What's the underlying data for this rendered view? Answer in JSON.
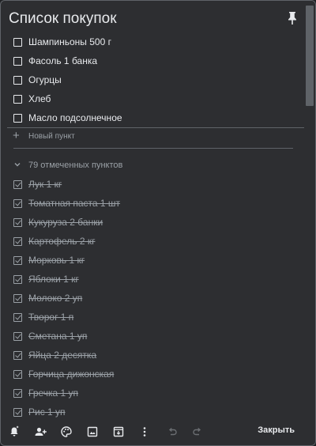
{
  "note": {
    "title": "Список покупок"
  },
  "unchecked_items": [
    {
      "label": "Шампиньоны 500 г",
      "checked": false
    },
    {
      "label": "Фасоль 1 банка",
      "checked": false
    },
    {
      "label": "Огурцы",
      "checked": false
    },
    {
      "label": "Хлеб",
      "checked": false
    },
    {
      "label": "Масло подсолнечное",
      "checked": false
    }
  ],
  "new_item": {
    "placeholder": "Новый пункт"
  },
  "checked_section": {
    "summary": "79 отмеченных пунктов",
    "expanded": true
  },
  "checked_items": [
    {
      "label": "Лук 1 кг",
      "checked": true
    },
    {
      "label": "Томатная паста 1 шт",
      "checked": true
    },
    {
      "label": "Кукуруза 2 банки",
      "checked": true
    },
    {
      "label": "Картофель 2 кг",
      "checked": true
    },
    {
      "label": "Морковь 1 кг",
      "checked": true
    },
    {
      "label": "Яблоки 1 кг",
      "checked": true
    },
    {
      "label": "Молоко 2 уп",
      "checked": true
    },
    {
      "label": "Творог 1 п",
      "checked": true
    },
    {
      "label": "Сметана 1 уп",
      "checked": true
    },
    {
      "label": "Яйца 2 десятка",
      "checked": true
    },
    {
      "label": "Горчица дижонская",
      "checked": true
    },
    {
      "label": "Гречка 1 уп",
      "checked": true
    },
    {
      "label": "Рис 1 уп",
      "checked": true
    }
  ],
  "toolbar": {
    "icons": [
      "reminder-icon",
      "collaborator-icon",
      "palette-icon",
      "image-icon",
      "archive-icon",
      "more-icon",
      "undo-icon",
      "redo-icon"
    ],
    "close_label": "Закрыть"
  },
  "colors": {
    "background": "#2d2e31",
    "text": "#e8eaed",
    "muted": "#9aa0a6",
    "border": "#5f6368",
    "spellcheck": "#d93025"
  }
}
